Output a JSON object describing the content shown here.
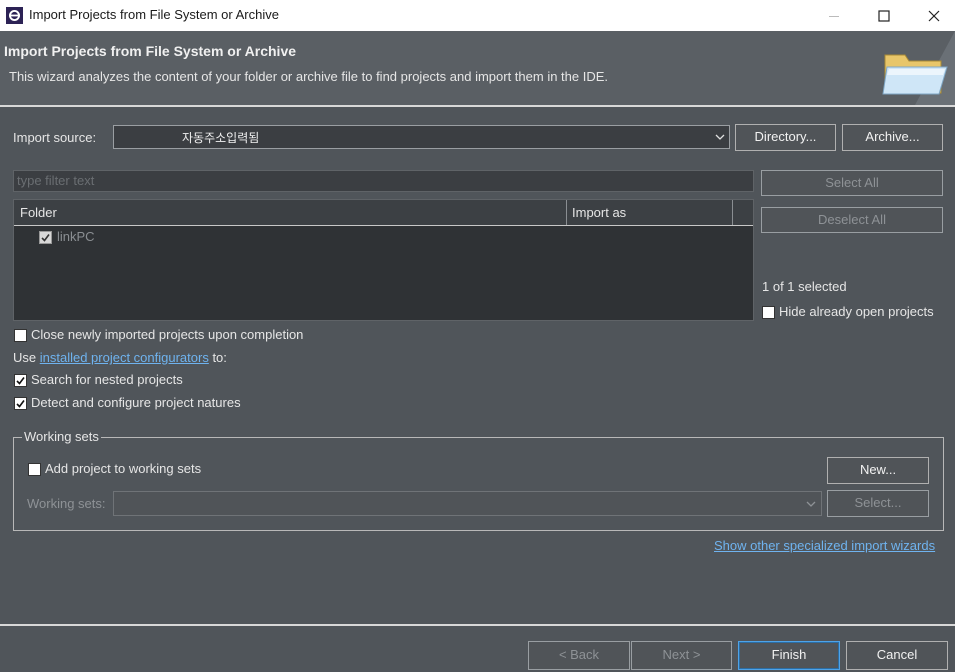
{
  "window": {
    "title": "Import Projects from File System or Archive",
    "controls": [
      "minimize-icon",
      "maximize-icon",
      "close-icon"
    ]
  },
  "header": {
    "title": "Import Projects from File System or Archive",
    "description": "This wizard analyzes the content of your folder or archive file to find projects and import them in the IDE.",
    "art_icon": "folder-icon"
  },
  "import_source": {
    "label": "Import source:",
    "value": "자동주소입력됨",
    "directory_button": "Directory...",
    "archive_button": "Archive..."
  },
  "filter": {
    "placeholder": "type filter text"
  },
  "table": {
    "columns": [
      "Folder",
      "Import as"
    ],
    "rows": [
      {
        "folder": "linkPC",
        "import_as": "",
        "checked": true
      }
    ]
  },
  "side": {
    "select_all": "Select All",
    "deselect_all": "Deselect All",
    "selected_count": "1 of 1 selected",
    "hide_open_label": "Hide already open projects",
    "hide_open_checked": false
  },
  "options": {
    "close_imported_label": "Close newly imported projects upon completion",
    "close_imported_checked": false,
    "use_prefix": "Use ",
    "configurators_link": "installed project configurators",
    "use_suffix": " to:",
    "nested_label": "Search for nested projects",
    "nested_checked": true,
    "natures_label": "Detect and configure project natures",
    "natures_checked": true
  },
  "working_sets": {
    "group_title": "Working sets",
    "add_label": "Add project to working sets",
    "add_checked": false,
    "new_button": "New...",
    "sets_label": "Working sets:",
    "select_button": "Select..."
  },
  "wizards_link": "Show other specialized import wizards",
  "footer": {
    "back": "< Back",
    "next": "Next >",
    "finish": "Finish",
    "cancel": "Cancel"
  },
  "colors": {
    "background": "#50555a",
    "header": "#5a5f64",
    "link": "#6fb3ef",
    "primary_border": "#4ea3e8"
  }
}
